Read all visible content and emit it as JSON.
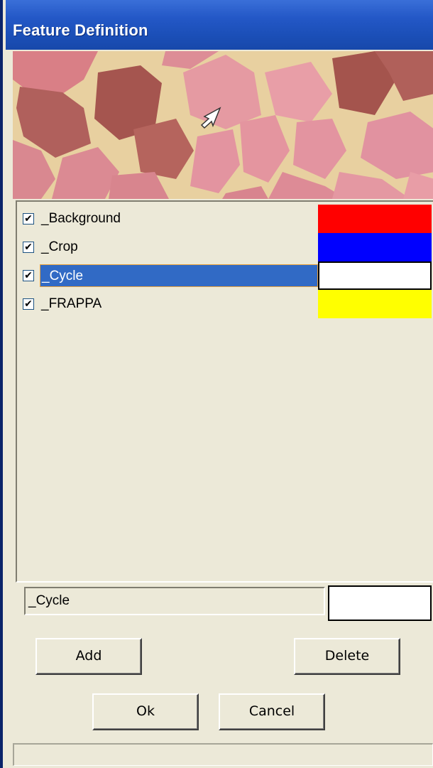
{
  "window": {
    "title": "Feature Definition"
  },
  "features": [
    {
      "label": "_Background",
      "checked": true,
      "color": "#ff0000",
      "selected": false
    },
    {
      "label": "_Crop",
      "checked": true,
      "color": "#0000ff",
      "selected": false
    },
    {
      "label": "_Cycle",
      "checked": true,
      "color": "#ffffff",
      "selected": true
    },
    {
      "label": "_FRAPPA",
      "checked": true,
      "color": "#ffff00",
      "selected": false
    }
  ],
  "editor": {
    "name_value": "_Cycle",
    "color": "#ffffff"
  },
  "buttons": {
    "add": "Add",
    "delete": "Delete",
    "ok": "Ok",
    "cancel": "Cancel"
  },
  "icons": {
    "check": "checkmark-icon",
    "cursor": "mouse-pointer-icon"
  },
  "colors": {
    "title_bar": "#1b4fb8",
    "selection": "#316ac5",
    "face": "#ece9d8"
  }
}
